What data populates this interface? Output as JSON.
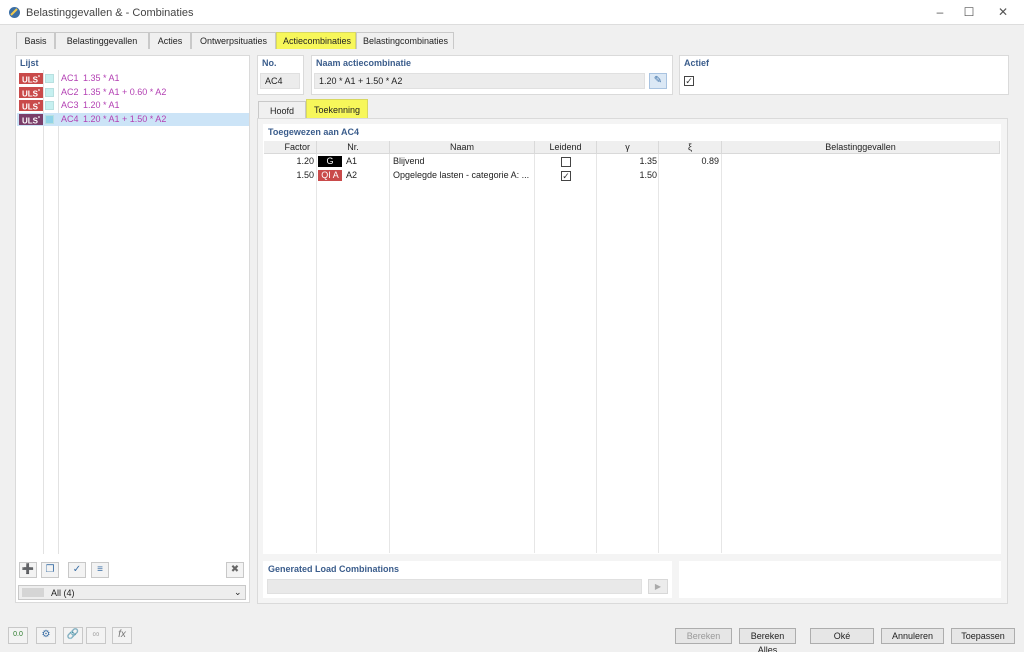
{
  "window": {
    "title": "Belastinggevallen & - Combinaties"
  },
  "tabs": [
    "Basis",
    "Belastinggevallen",
    "Acties",
    "Ontwerpsituaties",
    "Actiecombinaties",
    "Belastingcombinaties"
  ],
  "active_tab": "Actiecombinaties",
  "list": {
    "label": "Lijst",
    "items": [
      {
        "badge": "ULS",
        "id": "AC1",
        "formula": "1.35 * A1"
      },
      {
        "badge": "ULS",
        "id": "AC2",
        "formula": "1.35 * A1 + 0.60 * A2"
      },
      {
        "badge": "ULS",
        "id": "AC3",
        "formula": "1.20 * A1"
      },
      {
        "badge": "ULS",
        "id": "AC4",
        "formula": "1.20 * A1 + 1.50 * A2"
      }
    ],
    "selected": "AC4",
    "filter_value": "All (4)"
  },
  "no": {
    "label": "No.",
    "value": "AC4"
  },
  "naam": {
    "label": "Naam actiecombinatie",
    "value": "1.20 * A1 + 1.50 * A2"
  },
  "actief": {
    "label": "Actief",
    "checked": true
  },
  "subtabs": [
    "Hoofd",
    "Toekenning"
  ],
  "active_subtab": "Toekenning",
  "assigned": {
    "label": "Toegewezen aan AC4",
    "headers": [
      "Factor",
      "Nr.",
      "Naam",
      "Leidend",
      "γ",
      "ξ",
      "Belastinggevallen"
    ],
    "rows": [
      {
        "factor": "1.20",
        "tag": "G",
        "nr": "A1",
        "naam": "Blijvend",
        "leidend": false,
        "gamma": "1.35",
        "xi": "0.89",
        "bg": ""
      },
      {
        "factor": "1.50",
        "tag": "QI A",
        "nr": "A2",
        "naam": "Opgelegde lasten - categorie A: ...",
        "leidend": true,
        "gamma": "1.50",
        "xi": "",
        "bg": ""
      }
    ]
  },
  "generated": {
    "label": "Generated Load Combinations"
  },
  "buttons": {
    "bereken": "Bereken",
    "bereken_alles": "Bereken Alles",
    "oke": "Oké",
    "annuleren": "Annuleren",
    "toepassen": "Toepassen"
  },
  "colors": {
    "highlight": "#f7f75a",
    "uls": "#c94a4a",
    "tag_g": "#000000",
    "tag_q": "#c94a4a",
    "accent_label": "#3b5d8c",
    "formula": "#b340b3",
    "selected_row": "#cce4f7"
  }
}
